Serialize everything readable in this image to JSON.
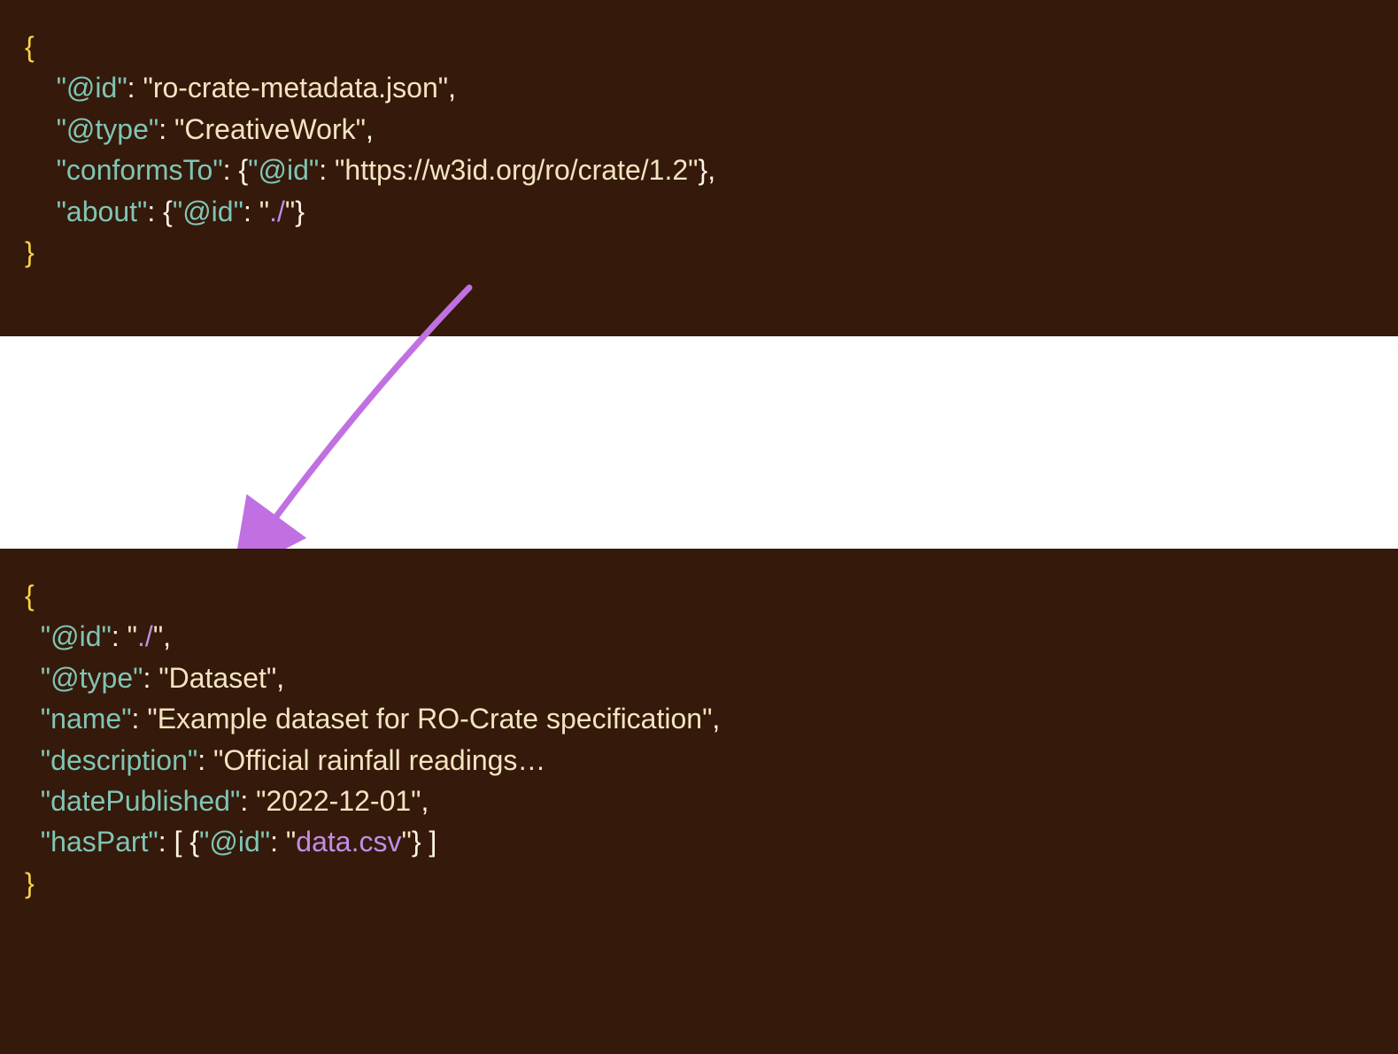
{
  "block1": {
    "open": "{",
    "l1_key": "\"@id\"",
    "l1_sep": ": ",
    "l1_val": "\"ro-crate-metadata.json\"",
    "l1_end": ",",
    "l2_key": "\"@type\"",
    "l2_sep": ": ",
    "l2_val": "\"CreativeWork\"",
    "l2_end": ",",
    "l3_key": "\"conformsTo\"",
    "l3_sep": ": {",
    "l3_ikey": "\"@id\"",
    "l3_isep": ": ",
    "l3_ival": "\"https://w3id.org/ro/crate/1.2\"",
    "l3_end": "},",
    "l4_key": "\"about\"",
    "l4_sep": ": {",
    "l4_ikey": "\"@id\"",
    "l4_isep": ": ",
    "l4_ival_q1": "\"",
    "l4_ival_link": "./",
    "l4_ival_q2": "\"",
    "l4_end": "}",
    "close": "}"
  },
  "block2": {
    "open": "{",
    "l1_key": "\"@id\"",
    "l1_sep": ": ",
    "l1_val_q1": "\"",
    "l1_val_link": "./",
    "l1_val_q2": "\"",
    "l1_end": ",",
    "l2_key": "\"@type\"",
    "l2_sep": ": ",
    "l2_val": "\"Dataset\"",
    "l2_end": ",",
    "l3_key": "\"name\"",
    "l3_sep": ": ",
    "l3_val": "\"Example dataset for RO-Crate specification\"",
    "l3_end": ",",
    "l4_key": "\"description\"",
    "l4_sep": ": ",
    "l4_val": "\"Official rainfall readings…",
    "l5_key": "\"datePublished\"",
    "l5_sep": ": ",
    "l5_val": "\"2022-12-01\"",
    "l5_end": ",",
    "l6_key": "\"hasPart\"",
    "l6_sep": ": [ {",
    "l6_ikey": "\"@id\"",
    "l6_isep": ": ",
    "l6_ival_q1": "\"",
    "l6_ival_link": "data.csv",
    "l6_ival_q2": "\"",
    "l6_end": "} ]",
    "close": "}"
  },
  "arrow_color": "#c070e0"
}
